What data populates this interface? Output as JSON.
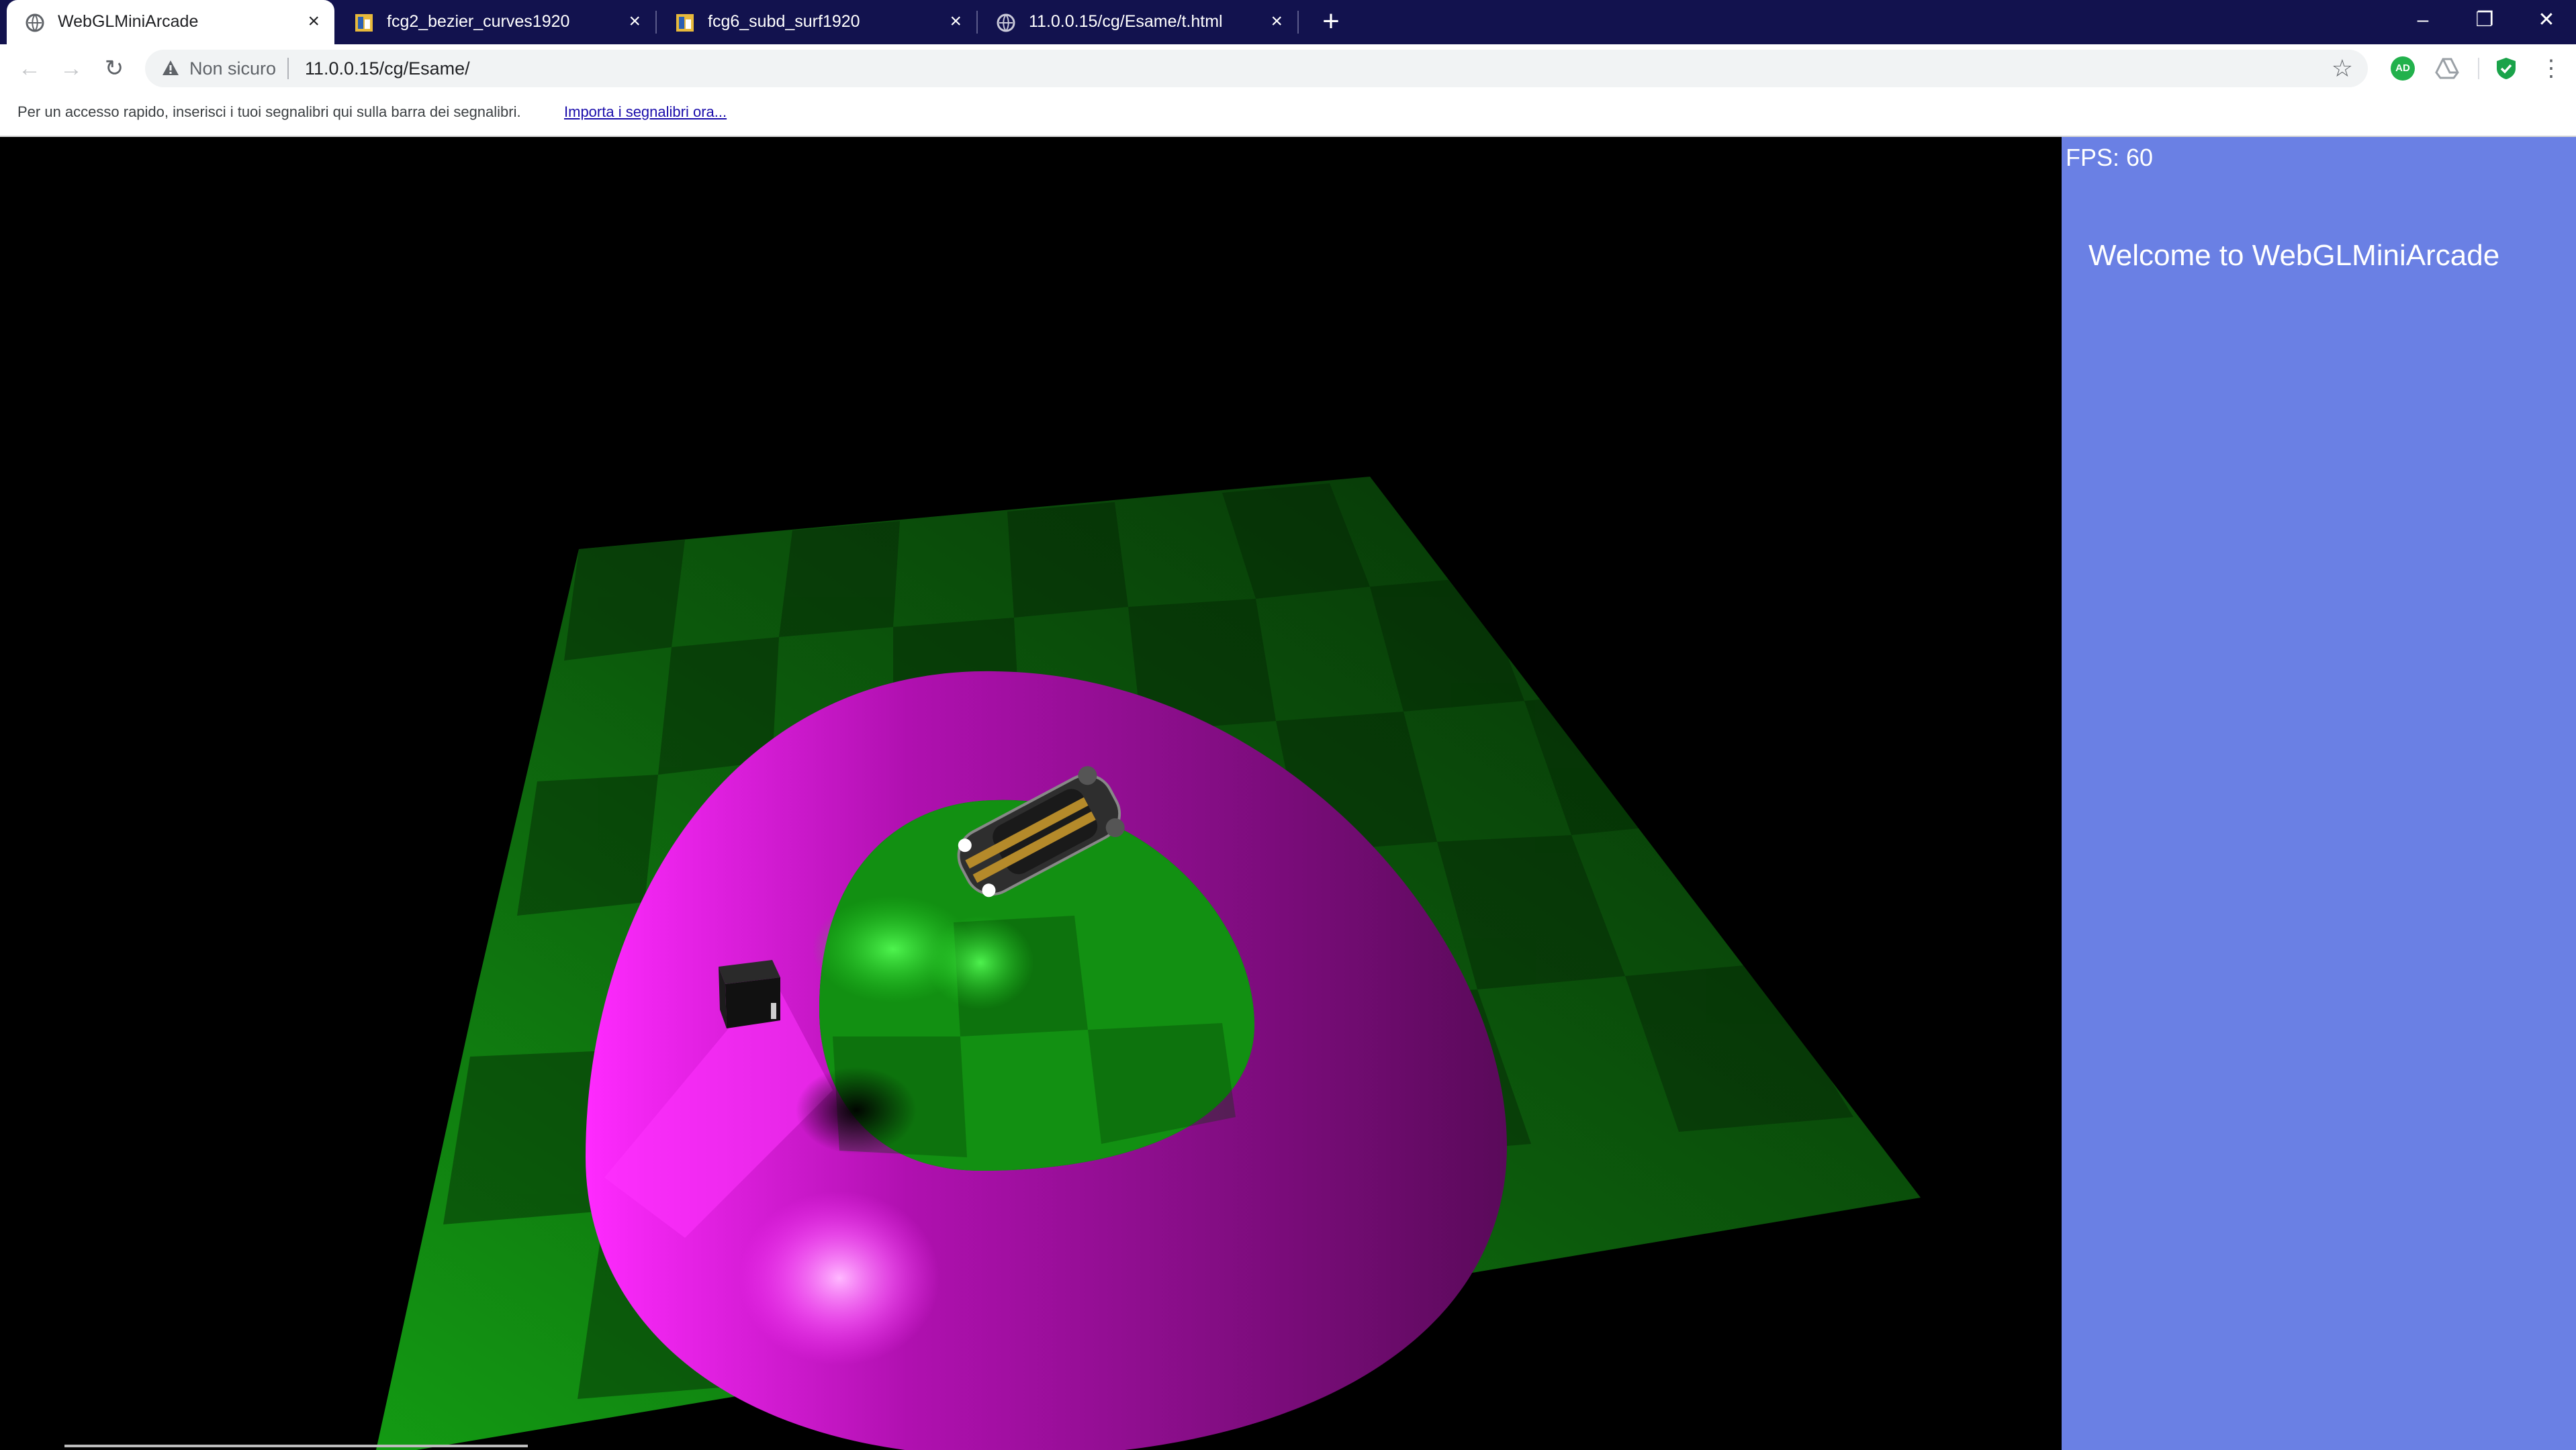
{
  "tabs": [
    {
      "title": "WebGLMiniArcade",
      "favicon": "globe-icon",
      "active": true
    },
    {
      "title": "fcg2_bezier_curves1920",
      "favicon": "file-image-icon",
      "active": false
    },
    {
      "title": "fcg6_subd_surf1920",
      "favicon": "file-image-icon",
      "active": false
    },
    {
      "title": "11.0.0.15/cg/Esame/t.html",
      "favicon": "globe-icon",
      "active": false
    }
  ],
  "toolbar": {
    "security_label": "Non sicuro",
    "url": "11.0.0.15/cg/Esame/",
    "extensions": [
      {
        "name": "adguard-icon",
        "text": "AD",
        "color": "#22b14c"
      },
      {
        "name": "drive-icon",
        "color": "#9aa0a6"
      },
      {
        "name": "shield-check-icon",
        "color": "#1aa34a"
      }
    ]
  },
  "bookmarks_bar": {
    "message": "Per un accesso rapido, inserisci i tuoi segnalibri qui sulla barra dei segnalibri.",
    "import_link": "Importa i segnalibri ora..."
  },
  "scene": {
    "floor_dark": "#0b3a0b",
    "floor_light": "#0f5a0f",
    "track_color": "#8e0f8e",
    "track_highlight": "#ff33ff",
    "inner_grass": "#16a016",
    "objects": [
      "car-model",
      "box-obstacle",
      "spotlight-glow",
      "shadow-blob"
    ]
  },
  "panel": {
    "fps_text": "FPS: 60",
    "welcome_text": "Welcome to WebGLMiniArcade"
  }
}
